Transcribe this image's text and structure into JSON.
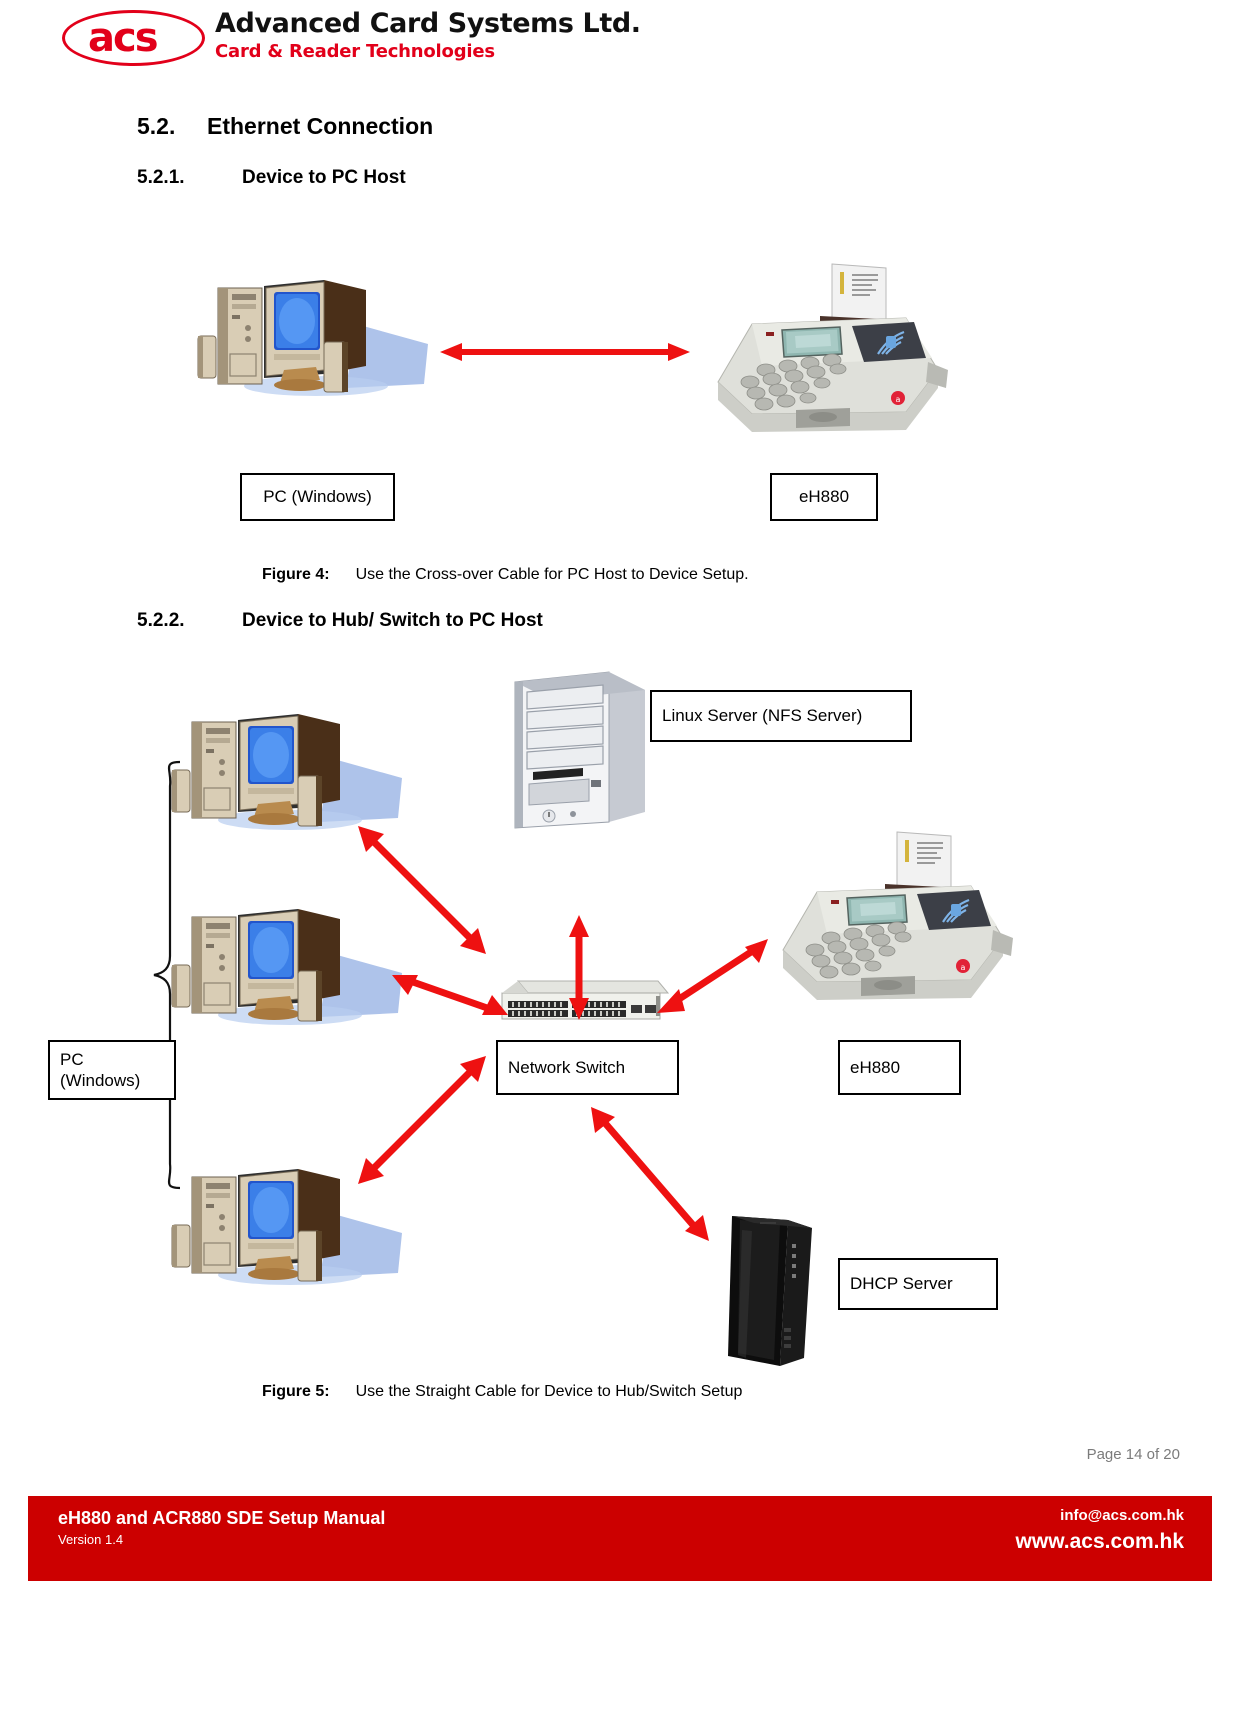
{
  "logo": {
    "mark_text": "acs",
    "company": "Advanced Card Systems Ltd.",
    "tagline": "Card & Reader Technologies",
    "brand_red": "#e2001a"
  },
  "sections": {
    "s52": {
      "number": "5.2.",
      "title": "Ethernet Connection"
    },
    "s521": {
      "number": "5.2.1.",
      "title": "Device to PC Host"
    },
    "s522": {
      "number": "5.2.2.",
      "title": "Device to Hub/ Switch to PC Host"
    }
  },
  "figure4": {
    "pc_label": "PC (Windows)",
    "device_label": "eH880",
    "caption_label": "Figure 4:",
    "caption_text": "Use the Cross-over Cable for PC Host to Device Setup."
  },
  "figure5": {
    "pc_label_line1": "PC",
    "pc_label_line2": "(Windows)",
    "linux_label": "Linux Server (NFS Server)",
    "switch_label": "Network Switch",
    "device_label": "eH880",
    "dhcp_label": "DHCP Server",
    "caption_label": "Figure 5:",
    "caption_text": "Use the Straight Cable for Device to Hub/Switch Setup"
  },
  "footer": {
    "page": "Page 14 of 20",
    "document": "eH880 and ACR880 SDE Setup Manual",
    "version": "Version 1.4",
    "email": "info@acs.com.hk",
    "website": "www.acs.com.hk",
    "bar_color": "#cc0000"
  },
  "colors": {
    "arrow_red": "#ee1111",
    "footer_red": "#cc0000",
    "brand_red": "#e2001a",
    "page_number_gray": "#7b7b7b"
  }
}
